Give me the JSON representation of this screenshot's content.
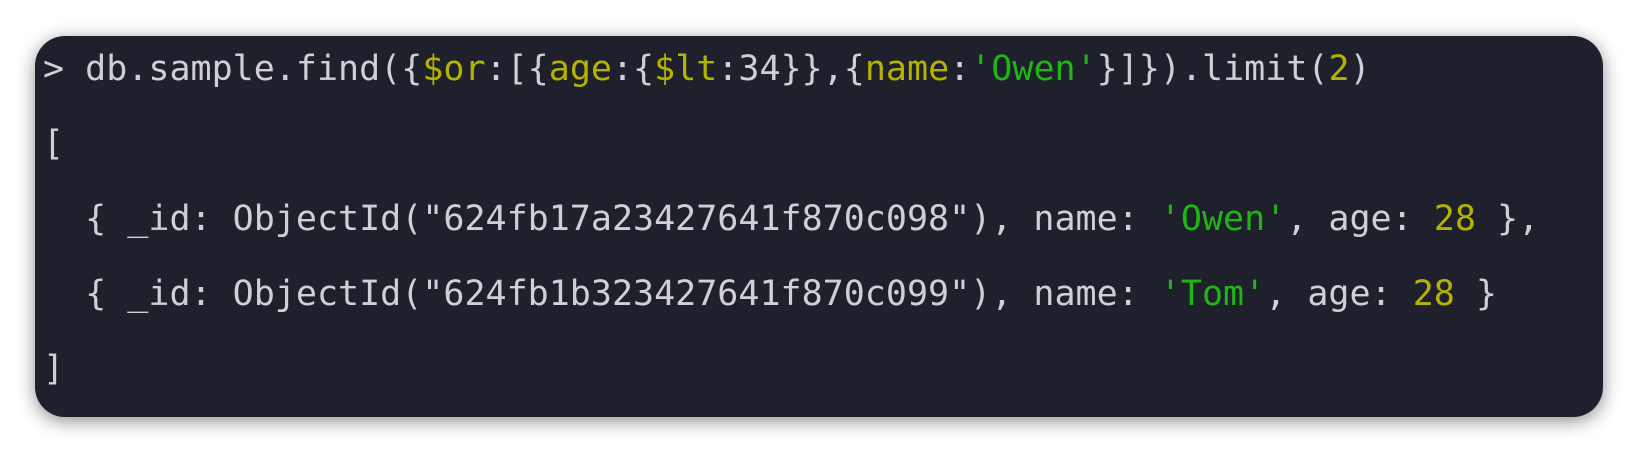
{
  "colors": {
    "terminal_bg": "#1e202c",
    "text": "#d0d0d4",
    "key_operator": "#b6b200",
    "string": "#1fb512",
    "number": "#b6b200"
  },
  "prompt": {
    "symbol": ">",
    "cmd_prefix": "db.sample.find({",
    "op_or": "$or",
    "sep1": ":[{",
    "key_age": "age",
    "sep2": ":{",
    "op_lt": "$lt",
    "sep3": ":34",
    "sep4": "}},{",
    "key_name": "name",
    "colon": ":",
    "value_owen": "'Owen'",
    "cmd_close": "}]}).limit(",
    "limit_value": "2",
    "paren_close": ")"
  },
  "output": {
    "open_bracket": "[",
    "close_bracket": "]",
    "results": [
      {
        "prefix": "{ _id: ObjectId(\"624fb17a23427641f870c098\"), name: ",
        "name": "'Owen'",
        "mid": ", age: ",
        "age": "28",
        "suffix": " },"
      },
      {
        "prefix": "{ _id: ObjectId(\"624fb1b323427641f870c099\"), name: ",
        "name": "'Tom'",
        "mid": ", age: ",
        "age": "28",
        "suffix": " }"
      }
    ]
  }
}
